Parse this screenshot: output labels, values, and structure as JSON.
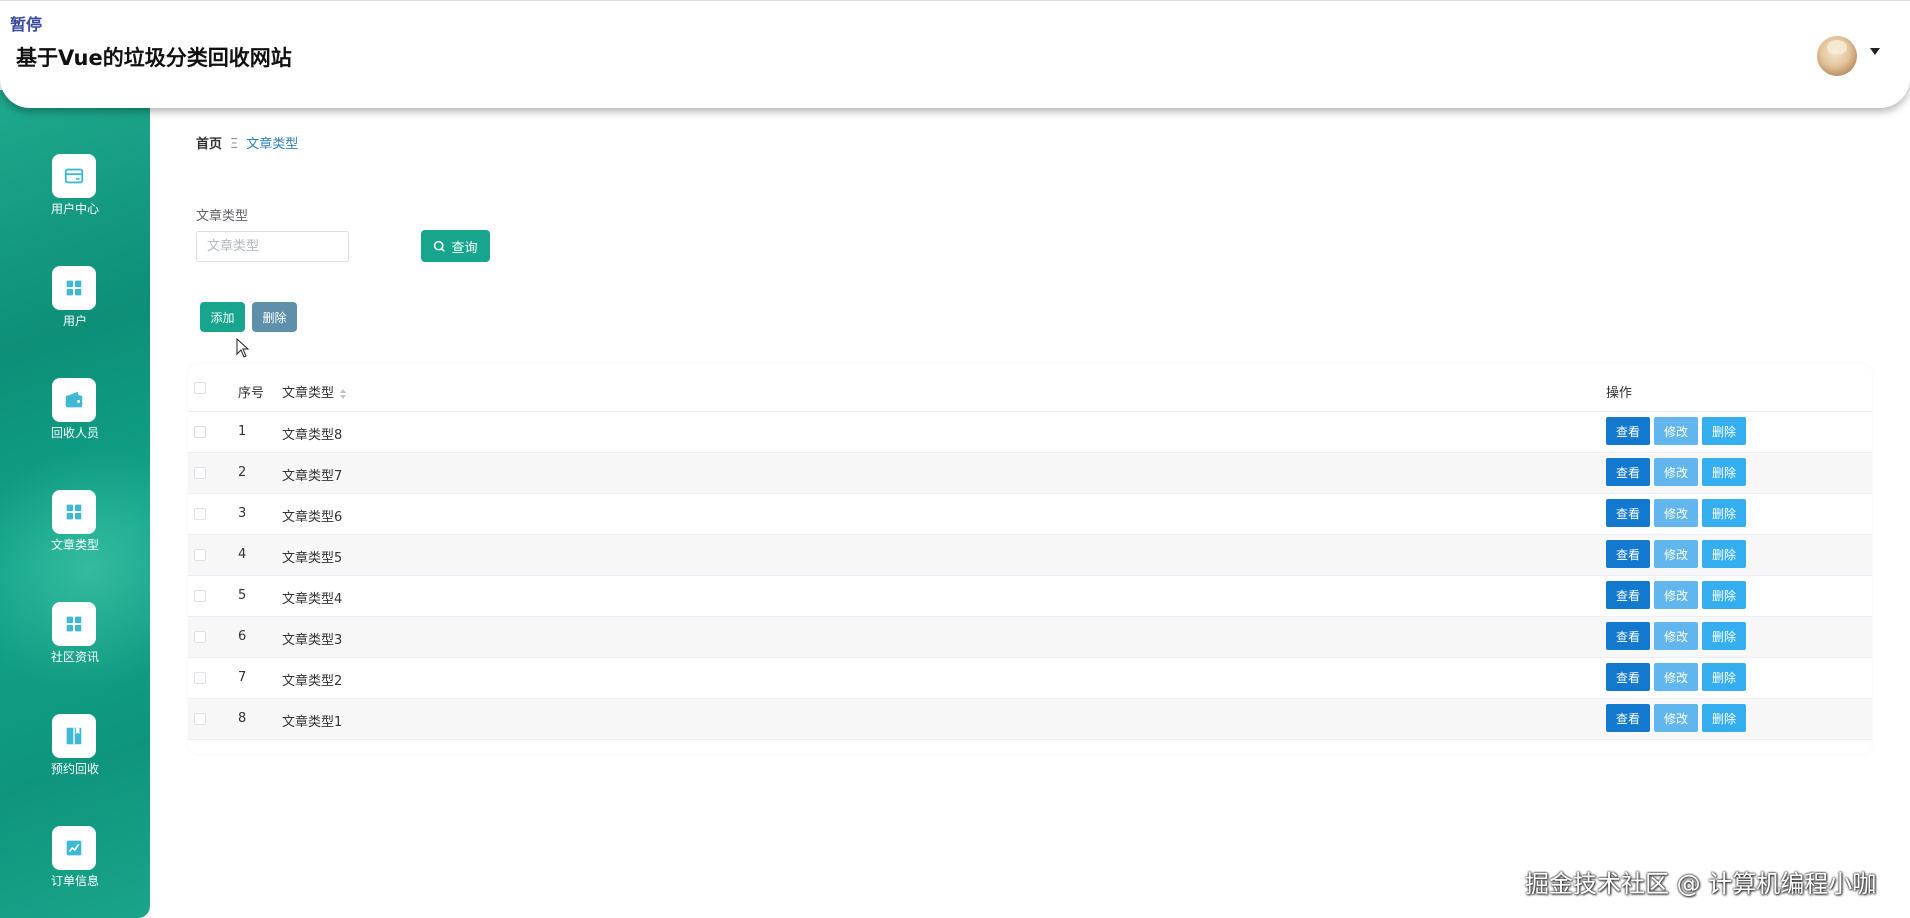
{
  "header": {
    "pause_label": "暂停",
    "title": "基于Vue的垃圾分类回收网站"
  },
  "sidebar": {
    "items": [
      {
        "label": "用户中心",
        "icon": "card-icon"
      },
      {
        "label": "用户",
        "icon": "grid-icon"
      },
      {
        "label": "回收人员",
        "icon": "wallet-icon"
      },
      {
        "label": "文章类型",
        "icon": "grid-icon"
      },
      {
        "label": "社区资讯",
        "icon": "grid-icon"
      },
      {
        "label": "预约回收",
        "icon": "book-icon"
      },
      {
        "label": "订单信息",
        "icon": "chart-icon"
      }
    ]
  },
  "breadcrumb": {
    "home": "首页",
    "separator": "Ξ",
    "current": "文章类型"
  },
  "filter": {
    "label": "文章类型",
    "placeholder": "文章类型",
    "value": "",
    "query_label": "查询"
  },
  "toolbar": {
    "add_label": "添加",
    "delete_label": "删除"
  },
  "table": {
    "columns": [
      "序号",
      "文章类型",
      "操作"
    ],
    "rows": [
      {
        "index": "1",
        "type": "文章类型8"
      },
      {
        "index": "2",
        "type": "文章类型7"
      },
      {
        "index": "3",
        "type": "文章类型6"
      },
      {
        "index": "4",
        "type": "文章类型5"
      },
      {
        "index": "5",
        "type": "文章类型4"
      },
      {
        "index": "6",
        "type": "文章类型3"
      },
      {
        "index": "7",
        "type": "文章类型2"
      },
      {
        "index": "8",
        "type": "文章类型1"
      }
    ],
    "actions": {
      "view": "查看",
      "edit": "修改",
      "delete": "删除"
    }
  },
  "watermark": "掘金技术社区 @ 计算机编程小咖",
  "colors": {
    "primary": "#17a68d",
    "view_button": "#1379cf",
    "edit_button": "#62b6ee",
    "delete_button": "#35aeef",
    "batch_delete_button": "#5e8fab",
    "sidebar_icon": "#3fb8d6"
  }
}
